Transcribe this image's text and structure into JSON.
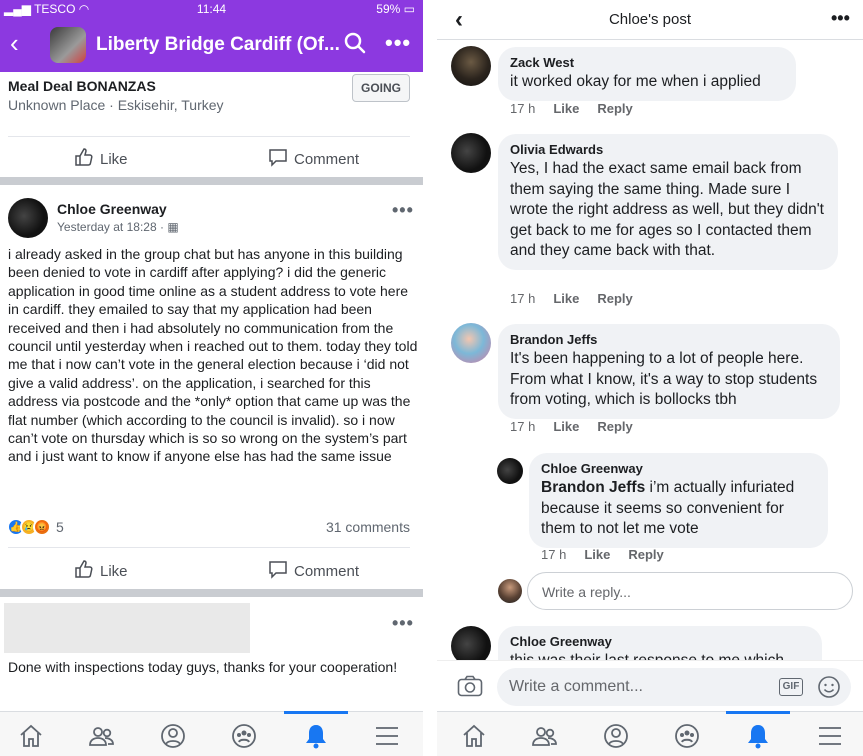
{
  "left": {
    "status": {
      "carrier": "TESCO",
      "time": "11:44",
      "battery": "59%"
    },
    "app": {
      "title": "Liberty Bridge Cardiff (Of..."
    },
    "event": {
      "title": "Meal Deal BONANZAS",
      "subtitle": "Unknown Place · Eskisehir, Turkey",
      "going_label": "GOING",
      "like_label": "Like",
      "comment_label": "Comment"
    },
    "post": {
      "author": "Chloe Greenway",
      "time": "Yesterday at 18:28 ·",
      "body": "i already asked in the group chat but has anyone in this building been denied to vote in cardiff after applying? i did the generic application in good time online as a student address to vote here in cardiff. they emailed to say that my application had been received and then i had absolutely no communication from the council until yesterday when i reached out to them. today they told me that i now can’t vote in the general election because i ‘did not give a valid address’. on the application, i searched for this address via postcode and the *only* option that came up was the flat number (which according to the council is invalid). so i now can’t vote on thursday which is so so wrong on the system’s part and i just want to know if anyone else has had the same issue",
      "reaction_count": "5",
      "comments_count": "31 comments",
      "like_label": "Like",
      "comment_label": "Comment"
    },
    "post2": {
      "body": "Done with inspections today guys, thanks for your cooperation!"
    }
  },
  "right": {
    "header_title": "Chloe's post",
    "comments": [
      {
        "name": "Zack West",
        "text": "it worked okay for me when i applied",
        "time": "17 h",
        "like": "Like",
        "reply": "Reply"
      },
      {
        "name": "Olivia Edwards",
        "text": "Yes, I had the exact same email back from them saying the same thing. Made sure I wrote the right address as well, but they didn't get back to me for ages so I contacted them and they came back with that.",
        "time": "17 h",
        "like": "Like",
        "reply": "Reply"
      },
      {
        "name": "Brandon Jeffs",
        "text": "It's been happening to a lot of people here. From what I know, it's a way to stop students from voting, which is bollocks tbh",
        "time": "17 h",
        "like": "Like",
        "reply": "Reply"
      }
    ],
    "reply": {
      "name": "Chloe Greenway",
      "mention": "Brandon Jeffs",
      "text": " i’m actually infuriated because it seems so convenient for them to not let me vote",
      "time": "17 h",
      "like": "Like",
      "reply": "Reply"
    },
    "reply_placeholder": "Write a reply...",
    "last_comment": {
      "name": "Chloe Greenway",
      "text": "this was their last response to me which"
    },
    "comment_placeholder": "Write a comment...",
    "gif_label": "GIF"
  },
  "colors": {
    "brand_purple": "#8c39e0",
    "facebook_blue": "#1877f2"
  }
}
